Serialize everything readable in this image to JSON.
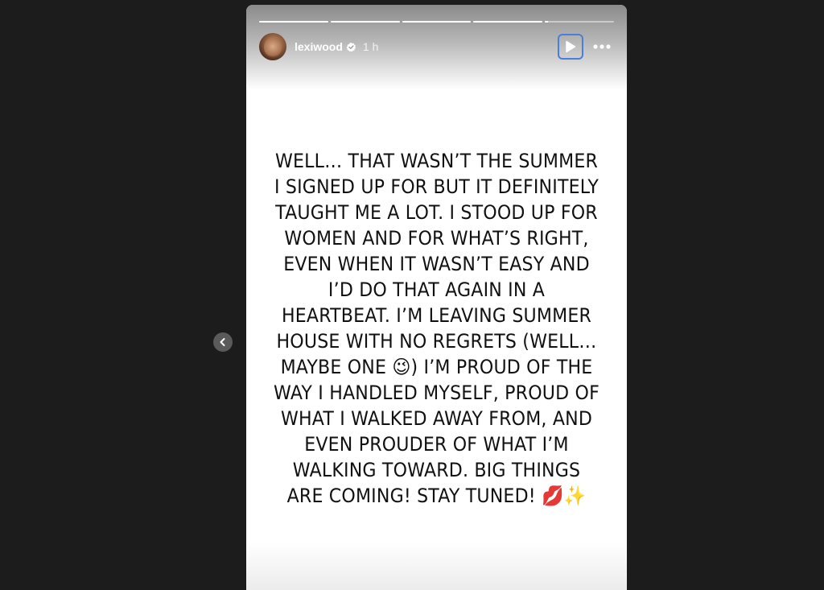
{
  "story": {
    "username": "lexiwood",
    "timestamp": "1 h",
    "progress": [
      1,
      1,
      1,
      1,
      0.05
    ],
    "text": "WELL… THAT WASN’T THE SUMMER I SIGNED UP FOR BUT IT DEFINITELY TAUGHT ME A LOT. I STOOD UP FOR WOMEN AND FOR WHAT’S RIGHT, EVEN WHEN IT WASN’T EASY AND I’D DO THAT AGAIN IN A HEARTBEAT. I’M LEAVING SUMMER HOUSE WITH NO REGRETS (WELL… MAYBE ONE 😉) I’M PROUD OF THE WAY I HANDLED MYSELF, PROUD OF WHAT I WALKED AWAY FROM, AND EVEN PROUDER OF WHAT I’M WALKING TOWARD. BIG THINGS ARE COMING! STAY TUNED! 💋✨"
  },
  "icons": {
    "verified": "verified-badge-icon",
    "play": "play-icon",
    "more": "more-options-icon",
    "previous": "chevron-left-icon"
  },
  "colors": {
    "background": "#1c1c1c",
    "story_bg": "#ffffff",
    "focus_ring": "#4a7fd8"
  }
}
